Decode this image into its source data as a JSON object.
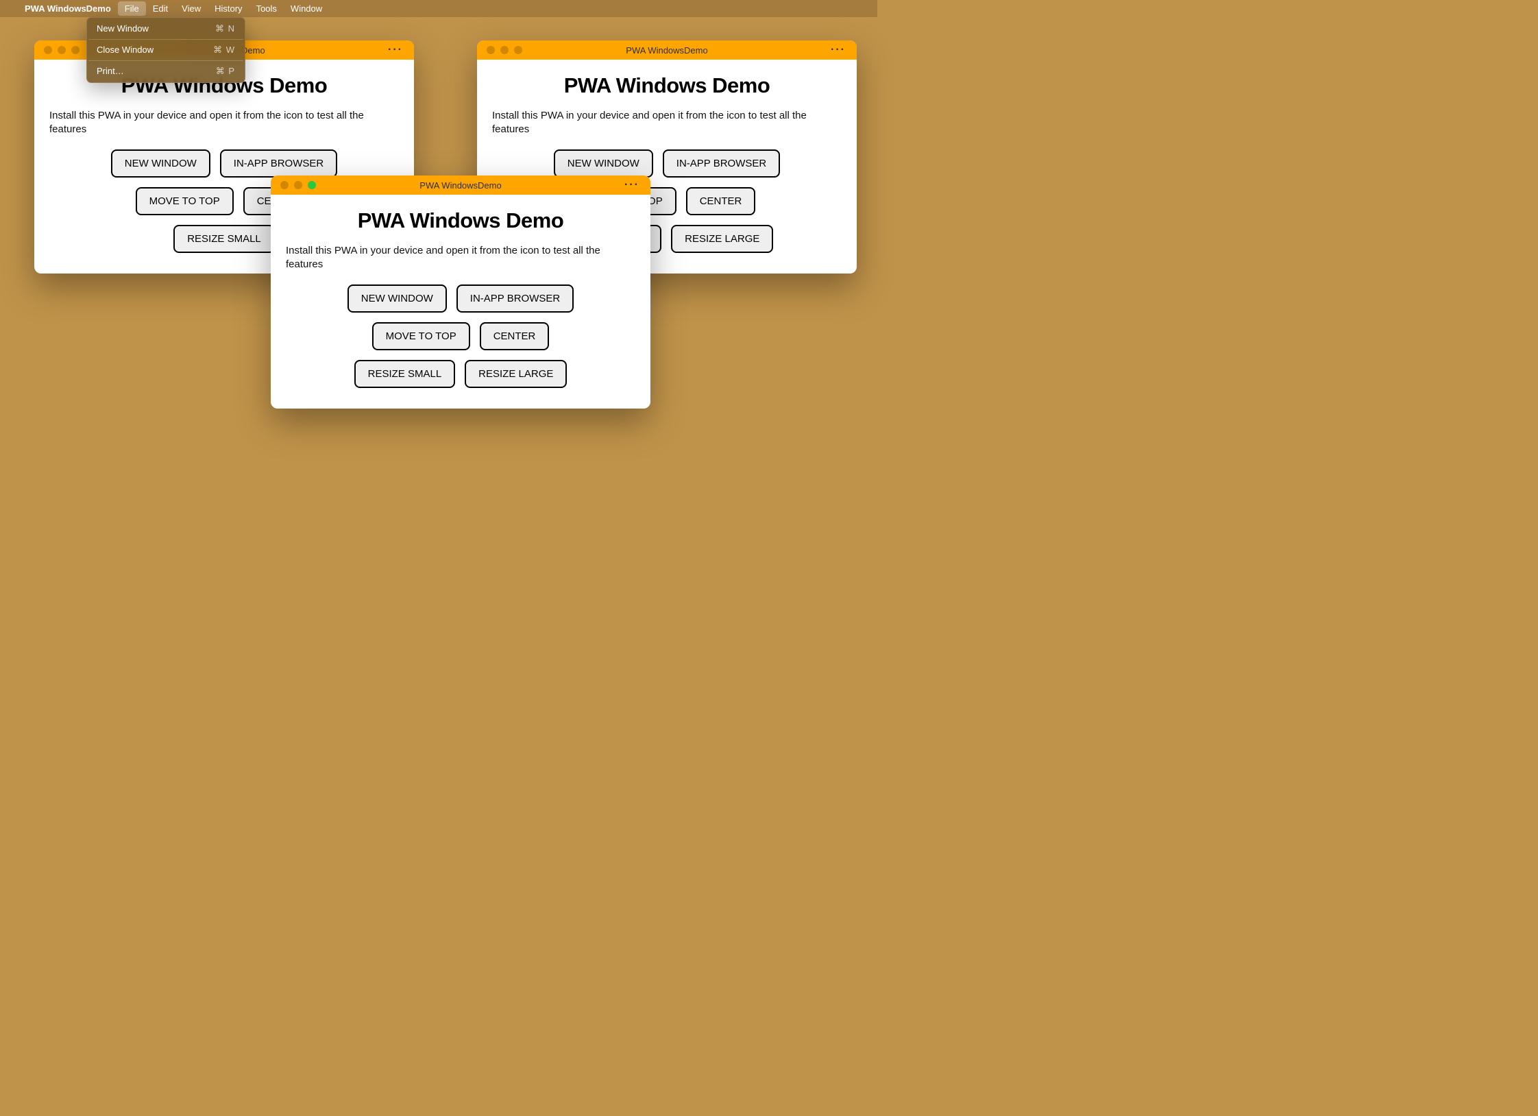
{
  "menubar": {
    "app_name": "PWA WindowsDemo",
    "items": [
      "File",
      "Edit",
      "View",
      "History",
      "Tools",
      "Window"
    ],
    "active_index": 0
  },
  "dropdown": {
    "items": [
      {
        "label": "New Window",
        "shortcut": "⌘ N"
      },
      {
        "label": "Close Window",
        "shortcut": "⌘ W"
      },
      {
        "label": "Print…",
        "shortcut": "⌘ P"
      }
    ]
  },
  "window_title": "PWA WindowsDemo",
  "content": {
    "heading": "PWA Windows Demo",
    "subtext": "Install this PWA in your device and open it from the icon to test all the features",
    "buttons": {
      "new_window": "NEW WINDOW",
      "in_app_browser": "IN-APP BROWSER",
      "move_to_top": "MOVE TO TOP",
      "center": "CENTER",
      "resize_small": "RESIZE SMALL",
      "resize_large": "RESIZE LARGE"
    }
  },
  "ellipsis": "···"
}
